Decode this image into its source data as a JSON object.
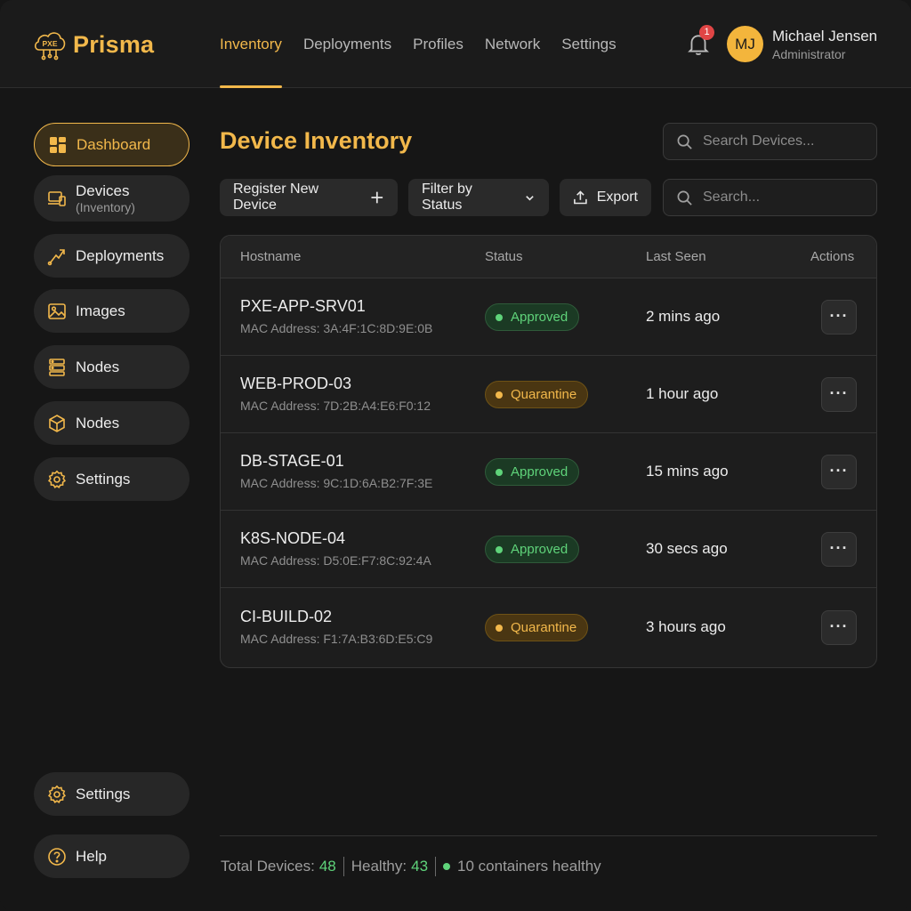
{
  "app": {
    "logo_badge": "PXE",
    "name": "Prisma"
  },
  "nav": {
    "items": [
      {
        "label": "Inventory",
        "active": true
      },
      {
        "label": "Deployments",
        "active": false
      },
      {
        "label": "Profiles",
        "active": false
      },
      {
        "label": "Network",
        "active": false
      },
      {
        "label": "Settings",
        "active": false
      }
    ]
  },
  "notifications": {
    "count": "1",
    "icon": "bell-icon"
  },
  "user": {
    "initials": "MJ",
    "name": "Michael Jensen",
    "role": "Administrator"
  },
  "sidebar": {
    "items": [
      {
        "label": "Dashboard",
        "icon": "dashboard-icon",
        "active": true
      },
      {
        "label": "Devices",
        "sublabel": "(Inventory)",
        "icon": "devices-icon"
      },
      {
        "label": "Deployments",
        "icon": "deploy-icon"
      },
      {
        "label": "Images",
        "icon": "image-icon"
      },
      {
        "label": "Nodes",
        "icon": "server-icon"
      },
      {
        "label": "Nodes",
        "icon": "cube-icon"
      },
      {
        "label": "Settings",
        "icon": "gear-icon"
      }
    ],
    "bottom": [
      {
        "label": "Settings",
        "icon": "gear-icon"
      },
      {
        "label": "Help",
        "icon": "help-icon"
      }
    ]
  },
  "main": {
    "title": "Device Inventory",
    "search_devices_placeholder": "Search Devices...",
    "toolbar": {
      "register_label": "Register New Device",
      "filter_label": "Filter by Status",
      "export_label": "Export",
      "search_placeholder": "Search..."
    },
    "table": {
      "columns": [
        "Hostname",
        "Status",
        "Last Seen",
        "Actions"
      ],
      "mac_prefix": "MAC Address:",
      "rows": [
        {
          "hostname": "PXE-APP-SRV01",
          "mac": "MAC Address: 3A:4F:1C:8D:9E:0B",
          "status": "Approved",
          "last_seen": "2 mins ago"
        },
        {
          "hostname": "WEB-PROD-03",
          "mac": "MAC Address: 7D:2B:A4:E6:F0:12",
          "status": "Quarantine",
          "last_seen": "1 hour ago"
        },
        {
          "hostname": "DB-STAGE-01",
          "mac": "MAC Address: 9C:1D:6A:B2:7F:3E",
          "status": "Approved",
          "last_seen": "15 mins ago"
        },
        {
          "hostname": "K8S-NODE-04",
          "mac": "MAC Address: D5:0E:F7:8C:92:4A",
          "status": "Approved",
          "last_seen": "30 secs ago"
        },
        {
          "hostname": "CI-BUILD-02",
          "mac": "MAC Address: F1:7A:B3:6D:E5:C9",
          "status": "Quarantine",
          "last_seen": "3 hours ago"
        }
      ],
      "actions_glyph": "···"
    }
  },
  "footer": {
    "total_label": "Total Devices:",
    "total_value": "48",
    "healthy_label": "Healthy:",
    "healthy_value": "43",
    "containers_text": "10 containers healthy"
  },
  "colors": {
    "accent": "#f2b84b",
    "approved": "#5fd37a",
    "quarantine": "#f2b84b",
    "badge_red": "#e04545"
  }
}
